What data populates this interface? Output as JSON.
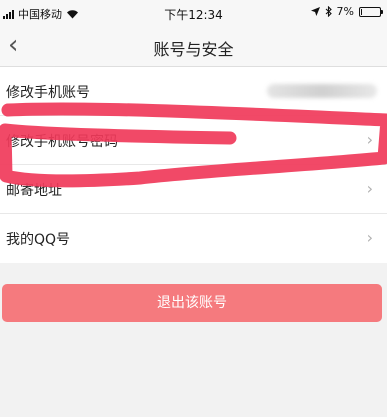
{
  "status_bar": {
    "carrier": "中国移动",
    "time": "下午12:34",
    "battery_percent": "7%",
    "battery_level": 0.07,
    "signal_icon": "signal-bars-icon",
    "wifi_icon": "wifi-icon",
    "location_icon": "location-arrow-icon",
    "bluetooth_icon": "bluetooth-icon"
  },
  "nav": {
    "title": "账号与安全",
    "back_icon": "chevron-left-icon"
  },
  "settings": [
    {
      "label": "修改手机账号",
      "value_hidden": true
    },
    {
      "label": "修改手机账号密码",
      "chevron": "chevron-right-icon"
    },
    {
      "label": "邮寄地址",
      "chevron": "chevron-right-icon"
    },
    {
      "label": "我的QQ号",
      "chevron": "chevron-right-icon"
    }
  ],
  "logout_button": {
    "label": "退出该账号",
    "color": "#f57a7e"
  },
  "annotation": {
    "color": "#f03a5a"
  }
}
